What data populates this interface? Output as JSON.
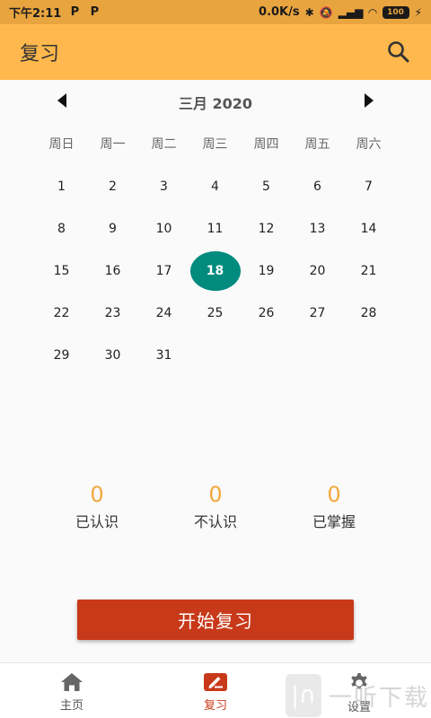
{
  "status_bar": {
    "time": "下午2:11",
    "app_badges": [
      "P",
      "P"
    ],
    "network_speed": "0.0K/s",
    "battery": "100"
  },
  "app_bar": {
    "title": "复习"
  },
  "calendar": {
    "month_label": "三月 2020",
    "weekdays": [
      "周日",
      "周一",
      "周二",
      "周三",
      "周四",
      "周五",
      "周六"
    ],
    "weeks": [
      [
        "1",
        "2",
        "3",
        "4",
        "5",
        "6",
        "7"
      ],
      [
        "8",
        "9",
        "10",
        "11",
        "12",
        "13",
        "14"
      ],
      [
        "15",
        "16",
        "17",
        "18",
        "19",
        "20",
        "21"
      ],
      [
        "22",
        "23",
        "24",
        "25",
        "26",
        "27",
        "28"
      ],
      [
        "29",
        "30",
        "31",
        "",
        "",
        "",
        ""
      ]
    ],
    "selected_day": "18",
    "selected_color": "#008b7e"
  },
  "stats": [
    {
      "value": "0",
      "label": "已认识"
    },
    {
      "value": "0",
      "label": "不认识"
    },
    {
      "value": "0",
      "label": "已掌握"
    }
  ],
  "start_button": {
    "label": "开始复习",
    "color": "#c8391a"
  },
  "bottom_nav": {
    "items": [
      {
        "label": "主页",
        "icon": "home-icon"
      },
      {
        "label": "复习",
        "icon": "review-icon"
      },
      {
        "label": "设置",
        "icon": "gear-icon"
      }
    ],
    "active_index": 1
  },
  "watermark": {
    "text": "一听下载"
  },
  "colors": {
    "app_bar": "#ffb84d",
    "status_bar": "#e8a43f",
    "accent_number": "#f2a93b"
  }
}
